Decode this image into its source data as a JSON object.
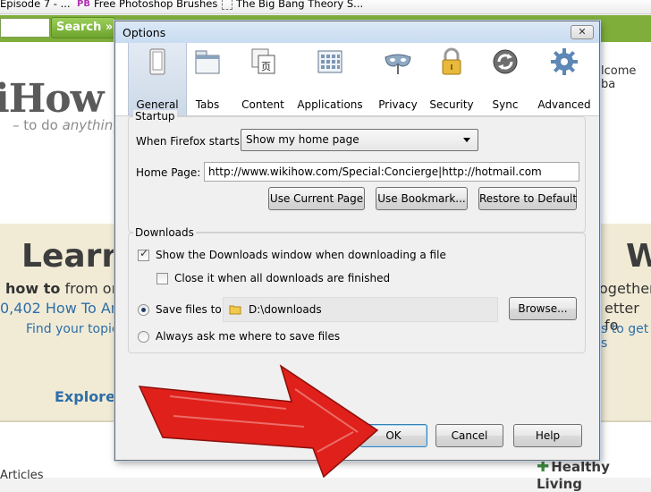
{
  "browser": {
    "bookmarks": [
      {
        "label": "Episode 7 - ..."
      },
      {
        "label": "Free Photoshop Brushes",
        "icon_text": "PB"
      },
      {
        "label": "The Big Bang Theory S..."
      }
    ],
    "search_button": "Search »"
  },
  "page": {
    "welcome": "lcome ba",
    "logo": "iHow",
    "tagline_prefix": "– to do ",
    "tagline_em": "anything",
    "learn": "Learn",
    "right_big": "W",
    "howto_bold": "how to",
    "howto_rest": " from or",
    "count": "0,402 How To Ar",
    "find_topic": "Find your topic.",
    "together": "ogether",
    "better": "etter fo",
    "to_get": "s to get s",
    "explore": "Explore",
    "articles": "Articles",
    "healthy_living": "Healthy Living"
  },
  "dialog": {
    "title": "Options",
    "close": "✕",
    "tabs": [
      {
        "label": "General",
        "icon": "general-switch-icon"
      },
      {
        "label": "Tabs",
        "icon": "tabs-window-icon"
      },
      {
        "label": "Content",
        "icon": "content-document-icon"
      },
      {
        "label": "Applications",
        "icon": "applications-grid-icon"
      },
      {
        "label": "Privacy",
        "icon": "privacy-mask-icon"
      },
      {
        "label": "Security",
        "icon": "security-padlock-icon"
      },
      {
        "label": "Sync",
        "icon": "sync-arrows-icon"
      },
      {
        "label": "Advanced",
        "icon": "advanced-gear-icon"
      }
    ],
    "startup": {
      "legend": "Startup",
      "when_label": "When Firefox starts:",
      "when_value": "Show my home page",
      "homepage_label": "Home Page:",
      "homepage_value": "http://www.wikihow.com/Special:Concierge|http://hotmail.com",
      "use_current": "Use Current Page",
      "use_bookmark": "Use Bookmark...",
      "restore_default": "Restore to Default"
    },
    "downloads": {
      "legend": "Downloads",
      "show_window": "Show the Downloads window when downloading a file",
      "show_window_checked": true,
      "close_when_done": "Close it when all downloads are finished",
      "close_when_done_checked": false,
      "save_files_label": "Save files to",
      "save_path": "D:\\downloads",
      "browse": "Browse...",
      "always_ask": "Always ask me where to save files",
      "selected_option": "save_files"
    },
    "buttons": {
      "ok": "OK",
      "cancel": "Cancel",
      "help": "Help"
    }
  },
  "colors": {
    "overlay_arrow": "#e0201a",
    "accent_green": "#7fae3b",
    "link_blue": "#2d6ea8"
  }
}
